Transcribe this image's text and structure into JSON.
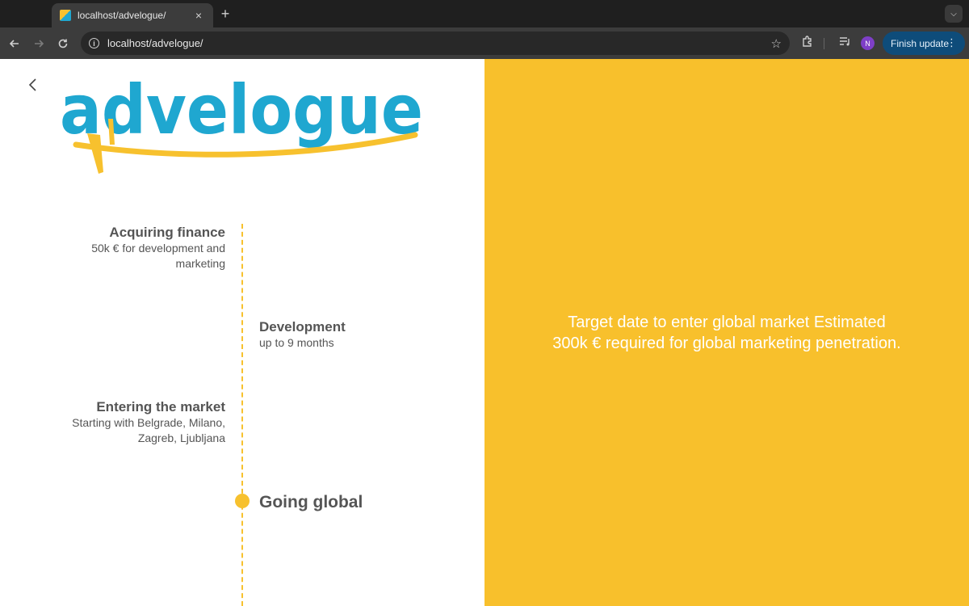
{
  "browser": {
    "tab_title": "localhost/advelogue/",
    "tab_close": "×",
    "new_tab": "+",
    "url": "localhost/advelogue/",
    "profile_initial": "N",
    "finish_update_label": "Finish update"
  },
  "logo": {
    "text": "advelogue",
    "colors": {
      "text": "#1fa7d0",
      "plane": "#f7c12e"
    }
  },
  "timeline": {
    "items": [
      {
        "title": "Acquiring finance",
        "description_lines": [
          "50k € for development and",
          "marketing"
        ]
      },
      {
        "title": "Development",
        "description_lines": [
          "up to 9 months"
        ]
      },
      {
        "title": "Entering the market",
        "description_lines": [
          "Starting with Belgrade, Milano,",
          "Zagreb, Ljubljana"
        ]
      },
      {
        "title": "Going global"
      }
    ],
    "line_color": "#f7c12e"
  },
  "panel": {
    "text_lines": [
      "Target date to enter global market Estimated",
      "300k € required for global marketing penetration."
    ],
    "background": "#f8c02c"
  }
}
